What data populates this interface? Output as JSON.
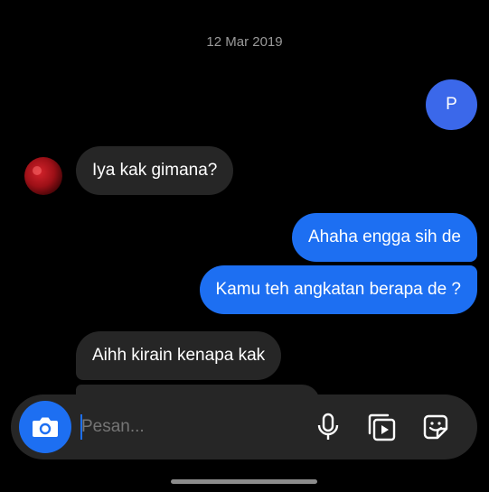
{
  "conversation": {
    "date_label": "12 Mar 2019",
    "messages": [
      {
        "id": "m1",
        "sender": "me",
        "text": "P"
      },
      {
        "id": "m2",
        "sender": "other",
        "text": "Iya kak gimana?"
      },
      {
        "id": "m3",
        "sender": "me",
        "text": "Ahaha engga sih de"
      },
      {
        "id": "m4",
        "sender": "me",
        "text": "Kamu teh angkatan berapa de ?"
      },
      {
        "id": "m5",
        "sender": "other",
        "text": "Aihh kirain kenapa kak"
      }
    ]
  },
  "composer": {
    "placeholder": "Pesan...",
    "icons": {
      "camera": "camera-icon",
      "microphone": "microphone-icon",
      "gallery": "gallery-icon",
      "sticker": "sticker-icon"
    }
  },
  "colors": {
    "background": "#000000",
    "sent_bubble": "#1d6ff2",
    "received_bubble": "#262626",
    "accent": "#1d6ff2"
  }
}
